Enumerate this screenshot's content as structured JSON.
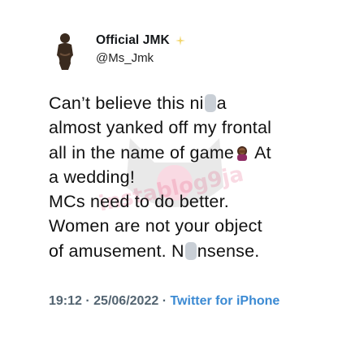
{
  "author": {
    "display_name": "Official JMK",
    "handle": "@Ms_Jmk",
    "avatar_icon": "person-silhouette-icon",
    "badge_icon": "sparkle-icon"
  },
  "tweet": {
    "line1_prefix": "Can’t believe this ni",
    "line1_suffix": "a",
    "line2": "almost yanked off my frontal",
    "line3_prefix": "all in the name of game",
    "line3_suffix": " At",
    "line4": "a wedding!",
    "line5": "MCs need to do better.",
    "line6": "Women are not your object",
    "line7_prefix": "of amusement. N",
    "line7_suffix": "nsense.",
    "emoji_icon": "woman-facepalm-emoji-icon",
    "censor_icon": "censor-blur-icon"
  },
  "meta": {
    "time": "19:12",
    "date": "25/06/2022",
    "separator": "·",
    "source": "Twitter for iPhone"
  },
  "watermark": {
    "text": "instablog9ja"
  },
  "colors": {
    "text": "#111111",
    "meta": "#536471",
    "link": "#3b8ad3",
    "watermark": "#e23a6b"
  }
}
